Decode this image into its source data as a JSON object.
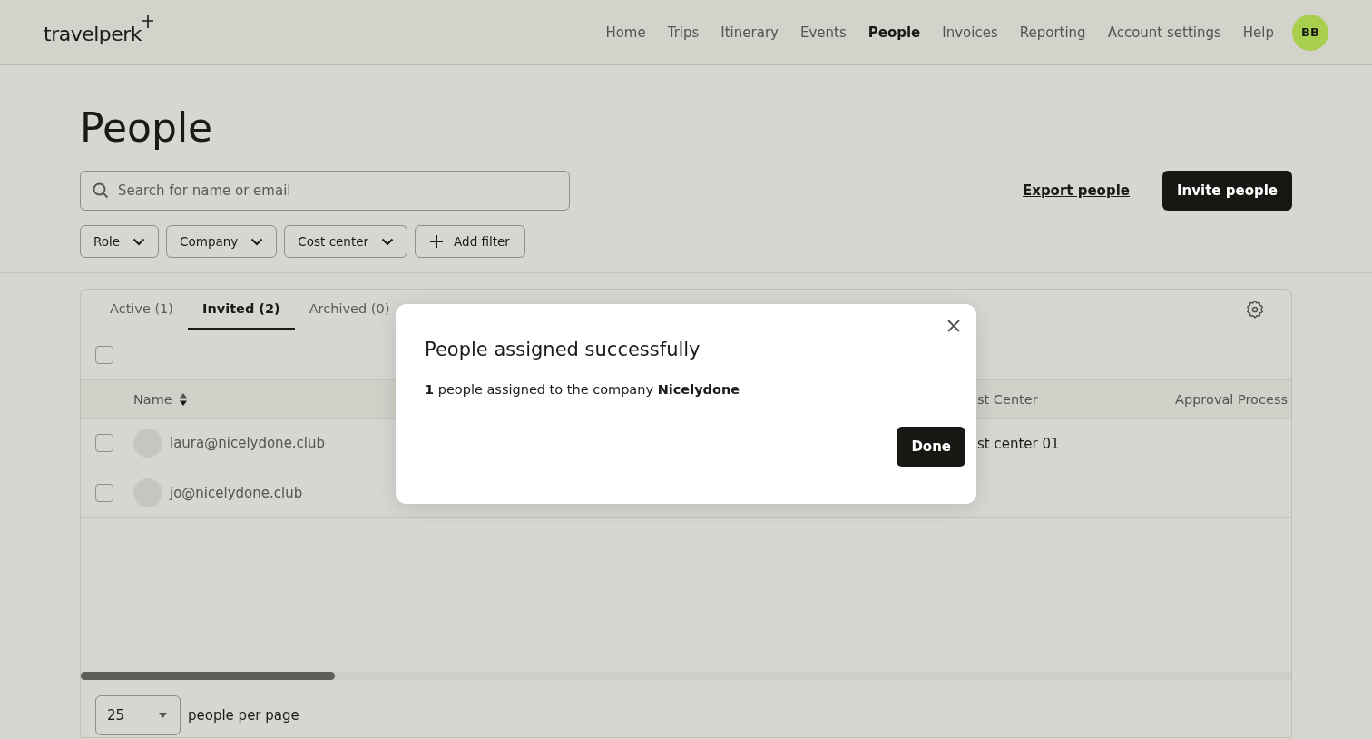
{
  "header": {
    "logo": "travelperk",
    "nav": [
      {
        "label": "Home",
        "selected": false
      },
      {
        "label": "Trips",
        "selected": false
      },
      {
        "label": "Itinerary",
        "selected": false
      },
      {
        "label": "Events",
        "selected": false
      },
      {
        "label": "People",
        "selected": true
      },
      {
        "label": "Invoices",
        "selected": false
      },
      {
        "label": "Reporting",
        "selected": false
      },
      {
        "label": "Account settings",
        "selected": false
      },
      {
        "label": "Help",
        "selected": false
      }
    ],
    "avatar": {
      "initials": "BB",
      "color": "#a9cf4e"
    }
  },
  "page": {
    "title": "People",
    "search": {
      "placeholder": "Search for name or email"
    },
    "export_link": "Export people",
    "invite_button": "Invite people",
    "filters": [
      {
        "label": "Role",
        "kind": "dropdown"
      },
      {
        "label": "Company",
        "kind": "dropdown"
      },
      {
        "label": "Cost center",
        "kind": "dropdown"
      },
      {
        "label": "Add filter",
        "kind": "add"
      }
    ]
  },
  "table": {
    "tabs": [
      {
        "label": "Active (1)",
        "selected": false
      },
      {
        "label": "Invited (2)",
        "selected": true
      },
      {
        "label": "Archived (0)",
        "selected": false
      }
    ],
    "select_all_checked": false,
    "columns": [
      {
        "label": "Name",
        "kind": "sortable"
      },
      {
        "label": "st Center",
        "kind": "plain"
      },
      {
        "label": "Approval Process",
        "kind": "right"
      }
    ],
    "rows": [
      {
        "checked": false,
        "email": "laura@nicelydone.club",
        "cost_center": "st center 01"
      },
      {
        "checked": false,
        "email": "jo@nicelydone.club"
      }
    ],
    "pagination": {
      "page_size": "25",
      "label": "people per page"
    }
  },
  "dialog": {
    "title": "People assigned successfully",
    "message": "**1** people assigned to the company **Nicelydone**",
    "button": "Done"
  }
}
